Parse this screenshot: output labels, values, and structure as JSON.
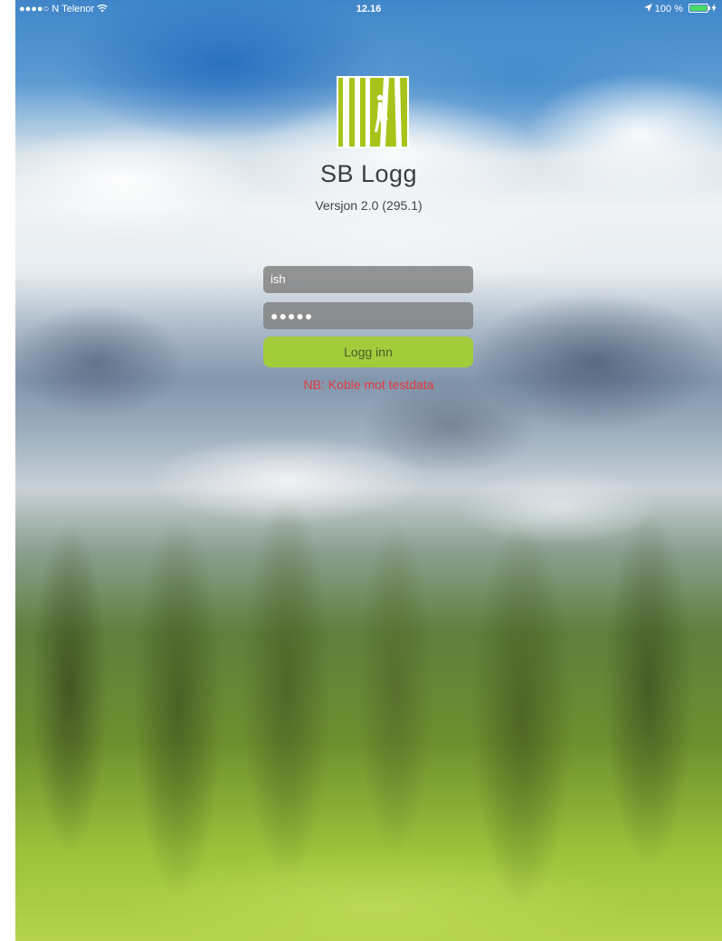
{
  "status_bar": {
    "carrier": "●●●●○ N Telenor",
    "wifi_icon": "wifi-icon",
    "time": "12.16",
    "location_icon": "location-arrow-icon",
    "battery_text": "100 %",
    "battery_level": 1.0,
    "charging_icon": "charging-bolt-icon"
  },
  "app": {
    "logo_icon": "sb-logg-logo",
    "logo_color": "#a6c41a",
    "title": "SB Logg",
    "version": "Versjon 2.0 (295.1)"
  },
  "login": {
    "username_value": "ish",
    "password_value": "●●●●●",
    "login_label": "Logg inn",
    "button_color": "#a3cc3c",
    "notice": "NB: Koble mot testdata",
    "notice_color": "#e0393e"
  }
}
